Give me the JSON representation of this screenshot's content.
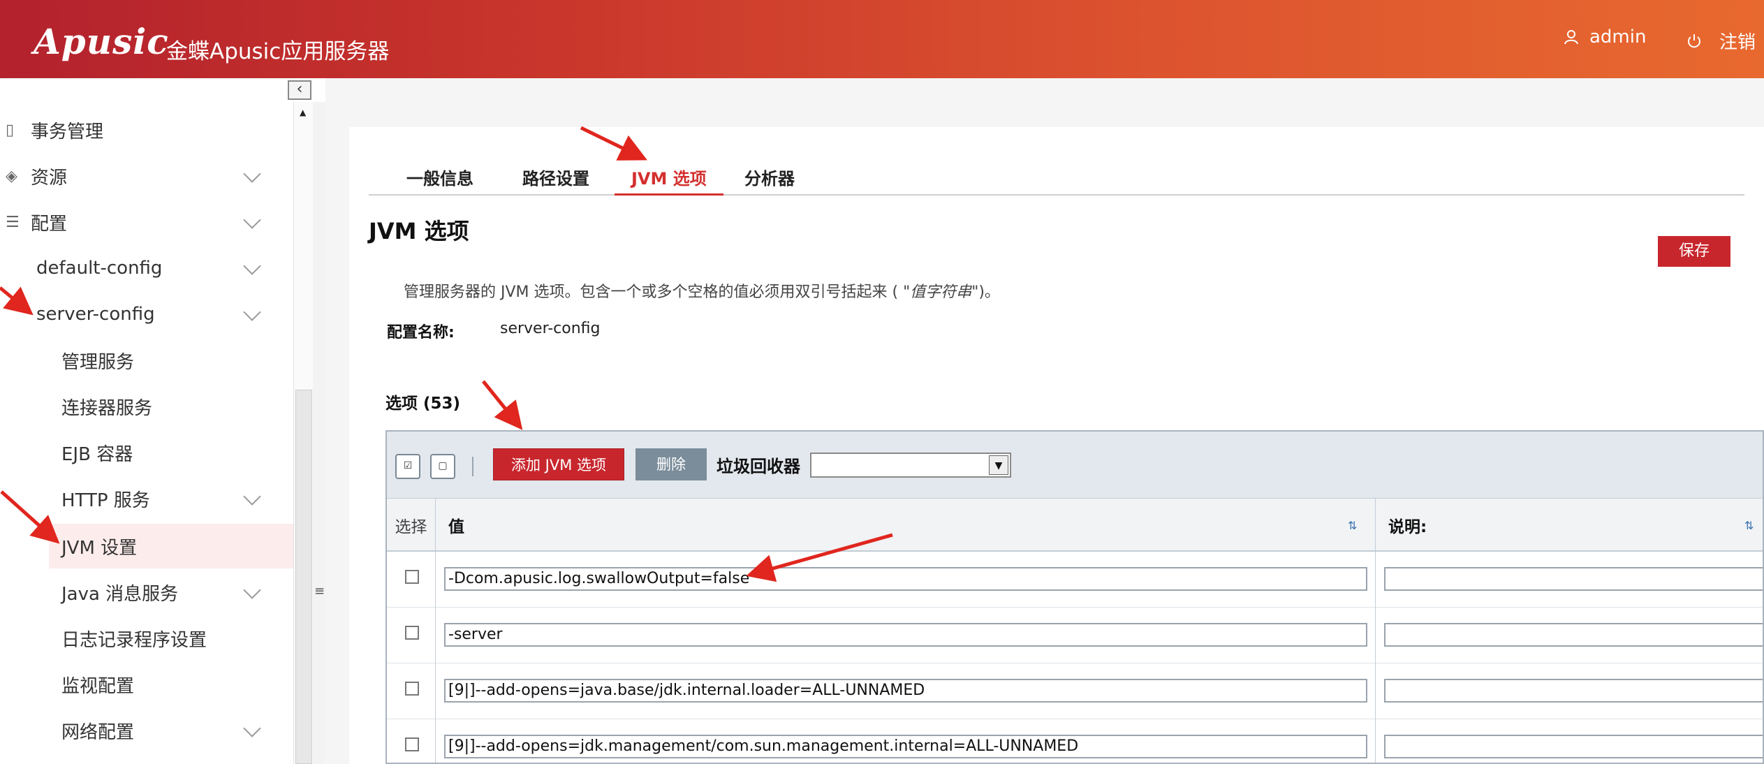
{
  "colors": {
    "header_start": "#b3222d",
    "header_end": "#e8692f",
    "accent": "#d3302f",
    "primary_button": "#c8262d",
    "secondary_button": "#7b8d9a"
  },
  "header": {
    "logo": "Apusic",
    "title": "金蝶Apusic应用服务器",
    "user": "admin",
    "logout": "注销",
    "user_icon": "user-icon",
    "power_icon": "power-icon"
  },
  "sidebar": {
    "items": [
      {
        "label": "事务管理",
        "icon": "document-icon"
      },
      {
        "label": "资源",
        "icon": "layers-icon"
      },
      {
        "label": "配置",
        "icon": "sliders-icon"
      },
      {
        "label": "default-config"
      },
      {
        "label": "server-config"
      },
      {
        "label": "管理服务"
      },
      {
        "label": "连接器服务"
      },
      {
        "label": "EJB 容器"
      },
      {
        "label": "HTTP 服务"
      },
      {
        "label": "JVM 设置"
      },
      {
        "label": "Java 消息服务"
      },
      {
        "label": "日志记录程序设置"
      },
      {
        "label": "监视配置"
      },
      {
        "label": "网络配置"
      }
    ]
  },
  "tabs": [
    {
      "label": "一般信息"
    },
    {
      "label": "路径设置"
    },
    {
      "label": "JVM 选项"
    },
    {
      "label": "分析器"
    }
  ],
  "page": {
    "title": "JVM 选项",
    "save_label": "保存",
    "description_prefix": "管理服务器的 JVM 选项。包含一个或多个空格的值必须用双引号括起来 ( \"",
    "description_em": "值字符串",
    "description_suffix": "\")。",
    "config_label": "配置名称:",
    "config_value": "server-config"
  },
  "options_table": {
    "title": "选项 (53)",
    "add_label": "添加 JVM 选项",
    "delete_label": "删除",
    "gc_label": "垃圾回收器",
    "gc_value": "",
    "columns": {
      "select": "选择",
      "value": "值",
      "note": "说明:"
    },
    "rows": [
      {
        "value": "-Dcom.apusic.log.swallowOutput=false",
        "note": ""
      },
      {
        "value": "-server",
        "note": ""
      },
      {
        "value": "[9|]--add-opens=java.base/jdk.internal.loader=ALL-UNNAMED",
        "note": ""
      },
      {
        "value": "[9|]--add-opens=jdk.management/com.sun.management.internal=ALL-UNNAMED",
        "note": ""
      }
    ]
  }
}
